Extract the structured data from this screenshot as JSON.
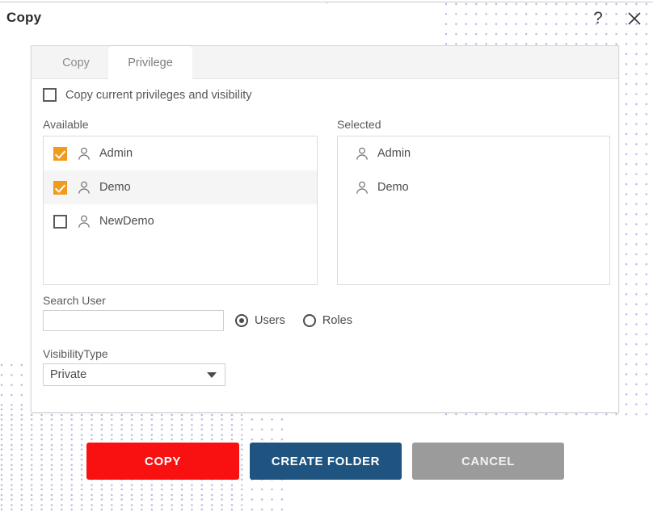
{
  "dialog": {
    "title": "Copy",
    "help_icon": "question-mark-icon",
    "close_icon": "close-icon"
  },
  "tabs": [
    {
      "label": "Copy",
      "active": false
    },
    {
      "label": "Privilege",
      "active": true
    }
  ],
  "copy_privileges_checkbox": {
    "label": "Copy current privileges and visibility",
    "checked": false
  },
  "available": {
    "header": "Available",
    "items": [
      {
        "name": "Admin",
        "checked": true,
        "highlighted": false
      },
      {
        "name": "Demo",
        "checked": true,
        "highlighted": true
      },
      {
        "name": "NewDemo",
        "checked": false,
        "highlighted": false
      }
    ]
  },
  "selected": {
    "header": "Selected",
    "items": [
      {
        "name": "Admin"
      },
      {
        "name": "Demo"
      }
    ]
  },
  "search": {
    "label": "Search User",
    "value": "",
    "placeholder": ""
  },
  "scope_radios": {
    "options": [
      {
        "label": "Users",
        "selected": true
      },
      {
        "label": "Roles",
        "selected": false
      }
    ]
  },
  "visibility": {
    "label": "VisibilityType",
    "value": "Private",
    "options": [
      "Private"
    ]
  },
  "footer_buttons": [
    {
      "label": "COPY",
      "color": "#f91010"
    },
    {
      "label": "CREATE FOLDER",
      "color": "#1f5480"
    },
    {
      "label": "CANCEL",
      "color": "#9b9b9b"
    }
  ]
}
